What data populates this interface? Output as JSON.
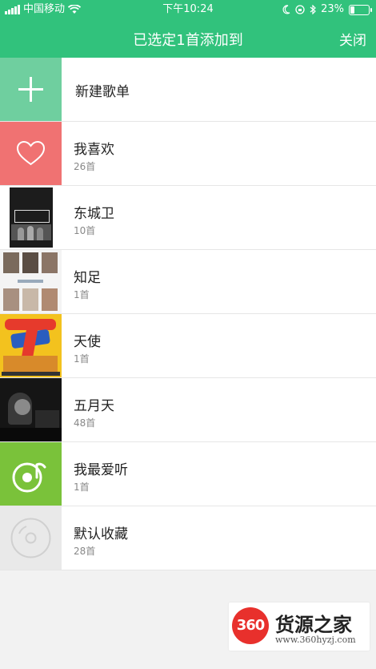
{
  "status_bar": {
    "carrier": "中国移动",
    "time": "下午10:24",
    "battery": "23%"
  },
  "header": {
    "title": "已选定1首添加到",
    "close_label": "关闭"
  },
  "colors": {
    "brand_green": "#31c27c",
    "new_playlist_bg": "#6fcf9f",
    "favorite_bg": "#f07272"
  },
  "playlists": [
    {
      "title": "新建歌单",
      "icon": "plus-icon"
    },
    {
      "title": "我喜欢",
      "count": "26首",
      "icon": "heart-icon"
    },
    {
      "title": "东城卫",
      "count": "10首"
    },
    {
      "title": "知足",
      "count": "1首"
    },
    {
      "title": "天使",
      "count": "1首"
    },
    {
      "title": "五月天",
      "count": "48首"
    },
    {
      "title": "我最爱听",
      "count": "1首",
      "icon": "music-disc-icon"
    },
    {
      "title": "默认收藏",
      "count": "28首",
      "icon": "disc-icon"
    }
  ],
  "watermark": {
    "badge": "360",
    "name": "货源之家",
    "url": "www.360hyzj.com"
  }
}
